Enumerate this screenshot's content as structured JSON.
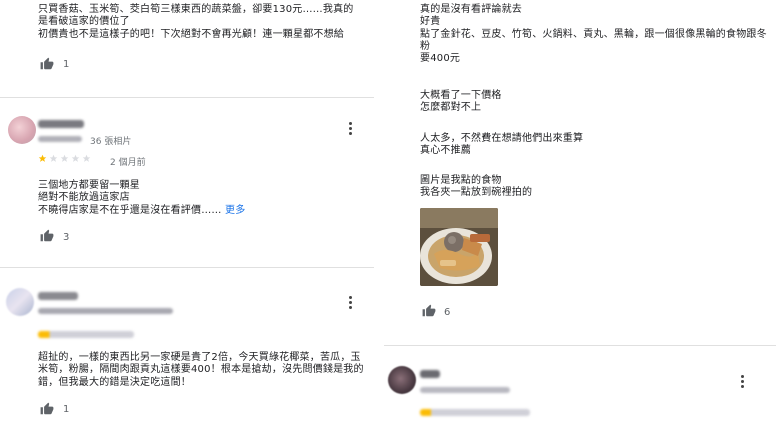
{
  "left": {
    "review1": {
      "text": "只買香菇、玉米筍、茭白筍三樣東西的蔬菜盤，卻要130元……我真的是看破這家的價位了\n初價貴也不是這樣子的吧！下次絕對不會再光顧！連一顆星都不想給",
      "likes": "1"
    },
    "review2": {
      "photo_count": "36 張相片",
      "time": "2 個月前",
      "rating": 1,
      "text": "三個地方都要留一顆星\n絕對不能放過這家店\n不曉得店家是不在乎還是沒在看評價……",
      "more": "更多",
      "likes": "3"
    },
    "review3": {
      "text": "超扯的，一樣的東西比另一家硬是貴了2倍，今天買綠花椰菜，苦瓜，玉米筍，粉腸，隔間肉跟貢丸這樣要400！根本是搶劫，沒先問價錢是我的錯，但我最大的錯是決定吃這間！",
      "likes": "1"
    }
  },
  "right": {
    "review_top": {
      "para1": "真的是沒有看評論就去\n好貴\n點了金針花、豆皮、竹筍、火鍋料、貢丸、黑輪，跟一個很像黑輪的食物跟冬粉\n要400元",
      "para2": "大概看了一下價格\n怎麼都對不上",
      "para3": "人太多，不然費在想請他們出來重算\n真心不推薦",
      "para4": "圖片是我點的食物\n我各夾一點放到碗裡拍的",
      "likes": "6"
    }
  },
  "colors": {
    "star": "#fbbc04",
    "star_empty": "#dadce0",
    "link": "#1a73e8",
    "icon": "#5f6368"
  },
  "icons": [
    "thumb-up-icon",
    "more-vert-icon",
    "star-icon"
  ]
}
